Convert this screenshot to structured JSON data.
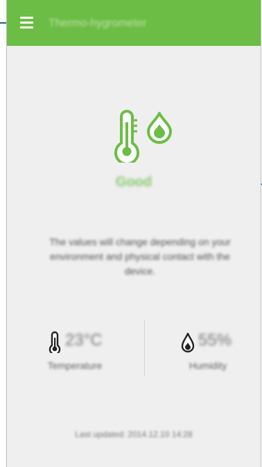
{
  "app": {
    "title": "Thermo-hygrometer",
    "accent_color": "#6cbd45",
    "menu_icon": "hamburger-menu-icon"
  },
  "hero": {
    "icon": "thermometer-droplet-icon",
    "status": "Good"
  },
  "description": "The values will change depending on your environment and physical contact with the device.",
  "metrics": {
    "temperature": {
      "icon": "thermometer-icon",
      "value": "23°C",
      "label": "Temperature"
    },
    "humidity": {
      "icon": "droplet-icon",
      "value": "55%",
      "label": "Humidity"
    }
  },
  "last_updated": "Last updated: 2014.12.10 14:28"
}
